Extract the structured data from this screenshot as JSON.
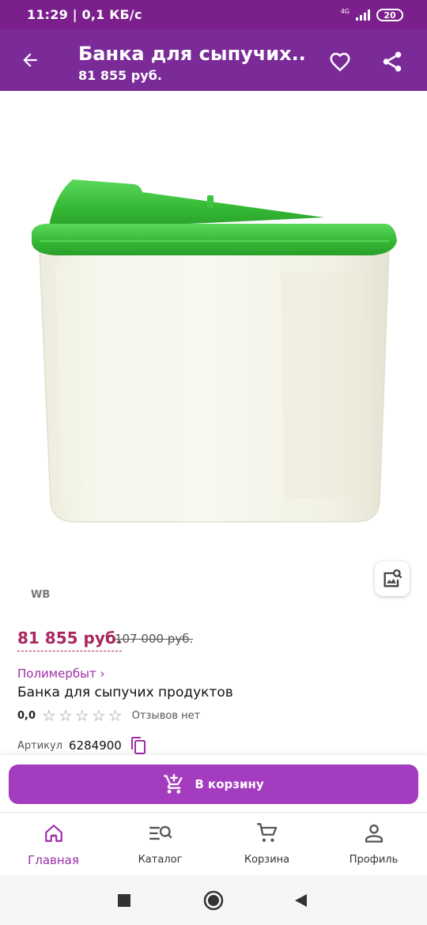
{
  "status_bar": {
    "time_and_speed": "11:29 | 0,1 КБ/с",
    "network": "4G",
    "battery": "20"
  },
  "app_bar": {
    "title": "Банка для сыпучих...",
    "price": "81 855 руб.",
    "back_icon": "arrow-left-icon",
    "favorite_icon": "heart-icon",
    "share_icon": "share-icon"
  },
  "image": {
    "description_icon": "image-search-icon",
    "brand_watermark": "WB"
  },
  "product": {
    "price_current": "81 855 руб.",
    "price_old": "107 000 руб.",
    "seller": "Полимербыт ›",
    "name": "Банка для сыпучих продуктов",
    "rating": "0,0",
    "stars": 0,
    "reviews": "Отзывов нет",
    "article_label": "Артикул",
    "article_value": "6284900"
  },
  "cart": {
    "label": "В корзину",
    "icon": "cart-plus-icon"
  },
  "bottom_nav": {
    "items": [
      {
        "label": "Главная",
        "icon": "home-icon"
      },
      {
        "label": "Каталог",
        "icon": "catalog-search-icon"
      },
      {
        "label": "Корзина",
        "icon": "cart-icon"
      },
      {
        "label": "Профиль",
        "icon": "profile-icon"
      }
    ]
  },
  "colors": {
    "status_bar": "#7b1f8c",
    "app_bar": "#7b2b98",
    "accent": "#a43cbf",
    "price": "#a8285f",
    "lid_green": "#3fc23f"
  }
}
